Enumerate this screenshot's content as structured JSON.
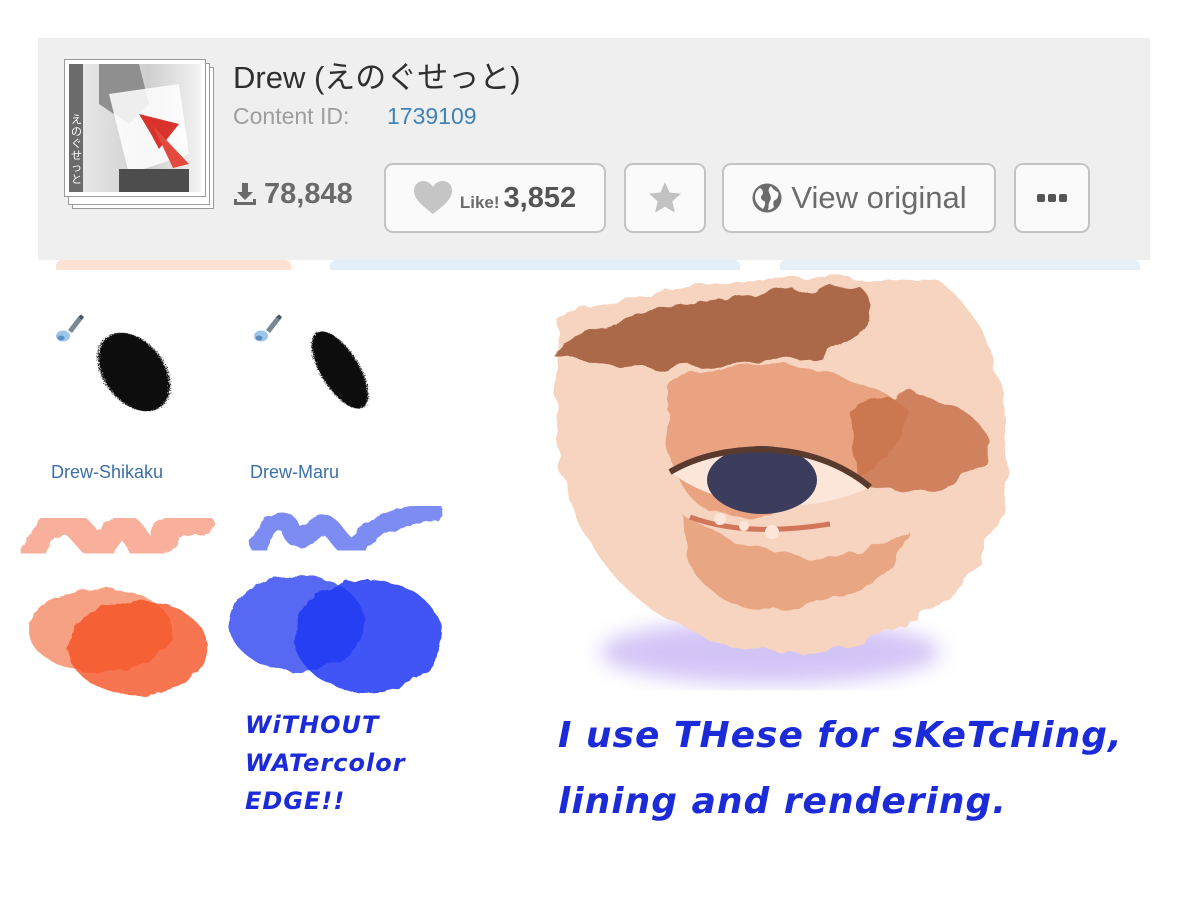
{
  "author": {
    "name": "Drew (えのぐせっと)",
    "thumbnail_text": "えのぐせっと"
  },
  "content": {
    "id_label": "Content ID:",
    "id_value": "1739109"
  },
  "stats": {
    "downloads": "78,848",
    "like_label": "Like!",
    "like_count": "3,852"
  },
  "buttons": {
    "view_original": "View original"
  },
  "brushes": [
    {
      "name": "Drew-Shikaku"
    },
    {
      "name": "Drew-Maru"
    }
  ],
  "notes": {
    "without_edge": "WiTHOUT\nWATercolor\nEDGE!!",
    "usage": "I use THese for sKeTcHing,\nlining and rendering."
  },
  "icons": {
    "download": "download-icon",
    "like": "heart-icon",
    "favorite": "star-icon",
    "view": "globe-icon",
    "more": "ellipsis-icon",
    "brush": "brush-icon"
  },
  "colors": {
    "accent_blue": "#3e82b6",
    "ink_blue": "#1b2bd8",
    "orange": "#f56a3a",
    "blue_paint": "#2f48f0"
  }
}
